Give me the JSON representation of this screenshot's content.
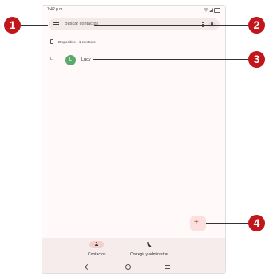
{
  "status_bar": {
    "time": "7:42 p.m."
  },
  "search": {
    "placeholder": "Buscar contactos"
  },
  "account_header": {
    "label": "Dispositivo • 1 contacto"
  },
  "contacts": [
    {
      "index_letter": "L",
      "initial": "L",
      "name": "Lucy",
      "avatar_color": "#5aa86b"
    }
  ],
  "fab": {
    "symbol": "+"
  },
  "bottom_nav": {
    "items": [
      {
        "label": "Contactos",
        "icon": "person-icon",
        "selected": true
      },
      {
        "label": "Corregir y administrar",
        "icon": "wrench-icon",
        "selected": false
      }
    ]
  },
  "callouts": [
    "1",
    "2",
    "3",
    "4"
  ],
  "colors": {
    "callout": "#c0161c",
    "accent": "#fbe0de",
    "nav_background": "#f6ecec"
  }
}
